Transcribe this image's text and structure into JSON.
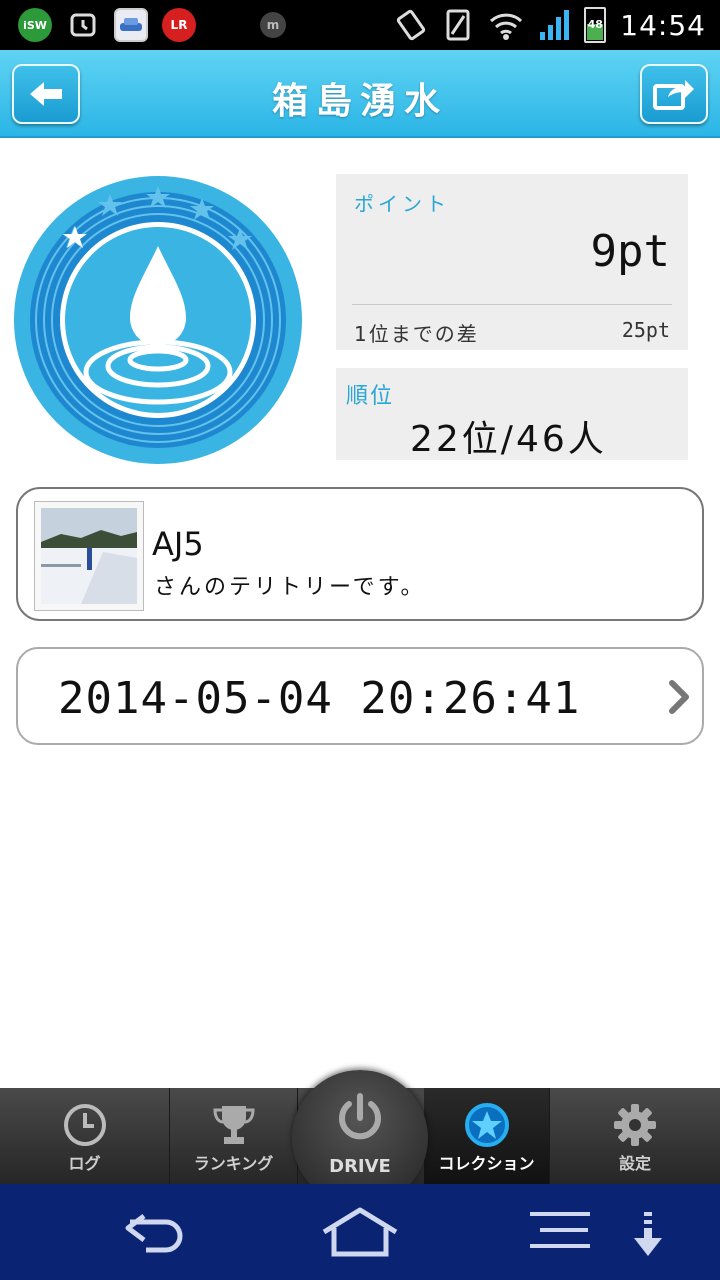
{
  "statusbar": {
    "time": "14:54",
    "battery": "48",
    "icons": [
      "isw-icon",
      "alarm-icon",
      "car-app-icon",
      "lr-icon",
      "m-icon",
      "rotate-icon",
      "vibrate-icon",
      "wifi-icon",
      "signal-icon",
      "battery-icon"
    ],
    "left_labels": {
      "isw": "iSW",
      "lr": "LR",
      "m": "m"
    }
  },
  "header": {
    "title": "箱島湧水",
    "back_icon": "arrow-left-icon",
    "share_icon": "share-icon"
  },
  "points": {
    "label": "ポイント",
    "value": "9pt",
    "diff_label": "1位までの差",
    "diff_value": "25pt"
  },
  "rank": {
    "label": "順位",
    "value": "22位/46人"
  },
  "territory": {
    "owner": "AJ5",
    "text": "さんのテリトリーです。"
  },
  "checkin": {
    "datetime": "2014-05-04 20:26:41"
  },
  "tabs": [
    {
      "label": "ログ",
      "icon": "clock-icon"
    },
    {
      "label": "ランキング",
      "icon": "trophy-icon"
    },
    {
      "label": "DRIVE",
      "icon": "power-icon"
    },
    {
      "label": "コレクション",
      "icon": "star-icon"
    },
    {
      "label": "設定",
      "icon": "gear-icon"
    }
  ],
  "navbar": {
    "icons": [
      "back-icon",
      "home-icon",
      "menu-icon",
      "download-icon"
    ]
  },
  "colors": {
    "accent": "#2bb5e6",
    "badge_outer": "#3ab4e2",
    "badge_ring": "#1d88cf",
    "navbar": "#0a2473"
  }
}
